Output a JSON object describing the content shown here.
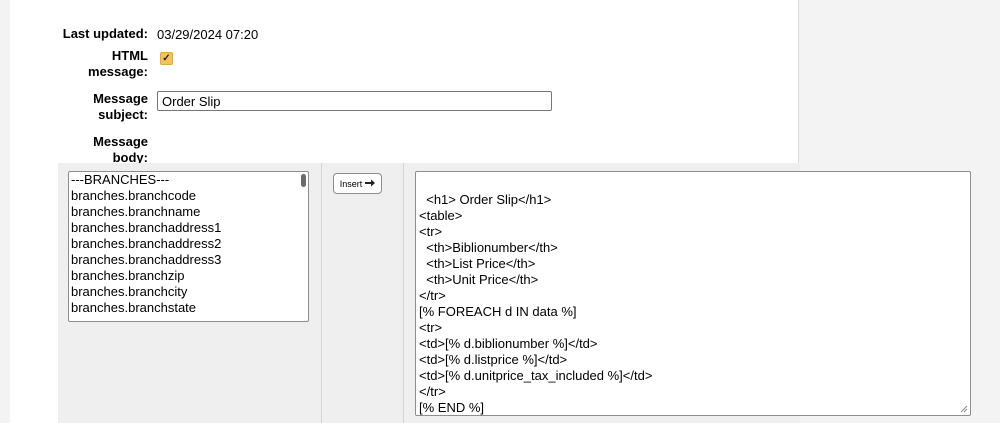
{
  "form": {
    "last_updated_label": "Last updated:",
    "last_updated_value": "03/29/2024 07:20",
    "html_message_label": "HTML message:",
    "html_message_checked": true,
    "subject_label": "Message subject:",
    "subject_value": "Order Slip",
    "body_label": "Message body:"
  },
  "fields_list": {
    "options": [
      "---BRANCHES---",
      "branches.branchcode",
      "branches.branchname",
      "branches.branchaddress1",
      "branches.branchaddress2",
      "branches.branchaddress3",
      "branches.branchzip",
      "branches.branchcity",
      "branches.branchstate"
    ]
  },
  "insert_button": {
    "label": "Insert",
    "icon": "arrow-right-icon"
  },
  "body_textarea": {
    "content": "<h1> Order Slip</h1>\n<table>\n<tr>\n  <th>Biblionumber</th>\n  <th>List Price</th>\n  <th>Unit Price</th>\n</tr>\n[% FOREACH d IN data %]\n<tr>\n<td>[% d.biblionumber %]</td>\n<td>[% d.listprice %]</td>\n<td>[% d.unitprice_tax_included %]</td>\n</tr>\n[% END %]\n</table>"
  },
  "colors": {
    "checkbox": "#f5c15b",
    "panel_bg": "#ffffff",
    "page_bg": "#f3f3f3"
  }
}
